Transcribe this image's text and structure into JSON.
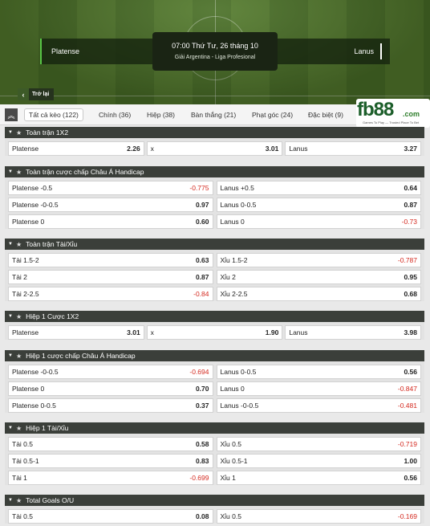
{
  "match": {
    "home": "Platense",
    "away": "Lanus",
    "datetime": "07:00 Thứ Tư, 26 tháng 10",
    "league": "Giải Argentina - Liga Profesional",
    "back_label": "Trở lại"
  },
  "tabs": [
    {
      "label": "Tất cả kèo (122)",
      "active": true
    },
    {
      "label": "Chính (36)"
    },
    {
      "label": "Hiệp (38)"
    },
    {
      "label": "Bàn thắng (21)"
    },
    {
      "label": "Phạt góc (24)"
    },
    {
      "label": "Đặc biệt (9)"
    }
  ],
  "logo": {
    "text": "fb88",
    "suffix": ".com",
    "tagline": "Games To Play — Trusted Place To Bet"
  },
  "markets": {
    "m1": {
      "title": "Toàn trận 1X2",
      "cells": [
        [
          "Platense",
          "2.26"
        ],
        [
          "x",
          "3.01"
        ],
        [
          "Lanus",
          "3.27"
        ]
      ]
    },
    "m2": {
      "title": "Toàn trận cược chấp Châu Á Handicap",
      "rows": [
        [
          [
            "Platense -0.5",
            "-0.775"
          ],
          [
            "Lanus +0.5",
            "0.64"
          ]
        ],
        [
          [
            "Platense -0-0.5",
            "0.97"
          ],
          [
            "Lanus 0-0.5",
            "0.87"
          ]
        ],
        [
          [
            "Platense 0",
            "0.60"
          ],
          [
            "Lanus 0",
            "-0.73"
          ]
        ]
      ]
    },
    "m3": {
      "title": "Toàn trận Tài/Xỉu",
      "rows": [
        [
          [
            "Tài 1.5-2",
            "0.63"
          ],
          [
            "Xỉu 1.5-2",
            "-0.787"
          ]
        ],
        [
          [
            "Tài 2",
            "0.87"
          ],
          [
            "Xỉu 2",
            "0.95"
          ]
        ],
        [
          [
            "Tài 2-2.5",
            "-0.84"
          ],
          [
            "Xỉu 2-2.5",
            "0.68"
          ]
        ]
      ]
    },
    "m4": {
      "title": "Hiệp 1 Cược 1X2",
      "cells": [
        [
          "Platense",
          "3.01"
        ],
        [
          "x",
          "1.90"
        ],
        [
          "Lanus",
          "3.98"
        ]
      ]
    },
    "m5": {
      "title": "Hiệp 1 cược chấp Châu Á Handicap",
      "rows": [
        [
          [
            "Platense -0-0.5",
            "-0.694"
          ],
          [
            "Lanus 0-0.5",
            "0.56"
          ]
        ],
        [
          [
            "Platense 0",
            "0.70"
          ],
          [
            "Lanus 0",
            "-0.847"
          ]
        ],
        [
          [
            "Platense 0-0.5",
            "0.37"
          ],
          [
            "Lanus -0-0.5",
            "-0.481"
          ]
        ]
      ]
    },
    "m6": {
      "title": "Hiệp 1 Tài/Xỉu",
      "rows": [
        [
          [
            "Tài 0.5",
            "0.58"
          ],
          [
            "Xỉu 0.5",
            "-0.719"
          ]
        ],
        [
          [
            "Tài 0.5-1",
            "0.83"
          ],
          [
            "Xỉu 0.5-1",
            "1.00"
          ]
        ],
        [
          [
            "Tài 1",
            "-0.699"
          ],
          [
            "Xỉu 1",
            "0.56"
          ]
        ]
      ]
    },
    "m7": {
      "title": "Total Goals O/U",
      "rows": [
        [
          [
            "Tài 0.5",
            "0.08"
          ],
          [
            "Xỉu 0.5",
            "-0.169"
          ]
        ]
      ]
    }
  },
  "colors": {
    "negative": "#d42a20",
    "header": "#3b3f3a",
    "accent": "#58c545"
  }
}
